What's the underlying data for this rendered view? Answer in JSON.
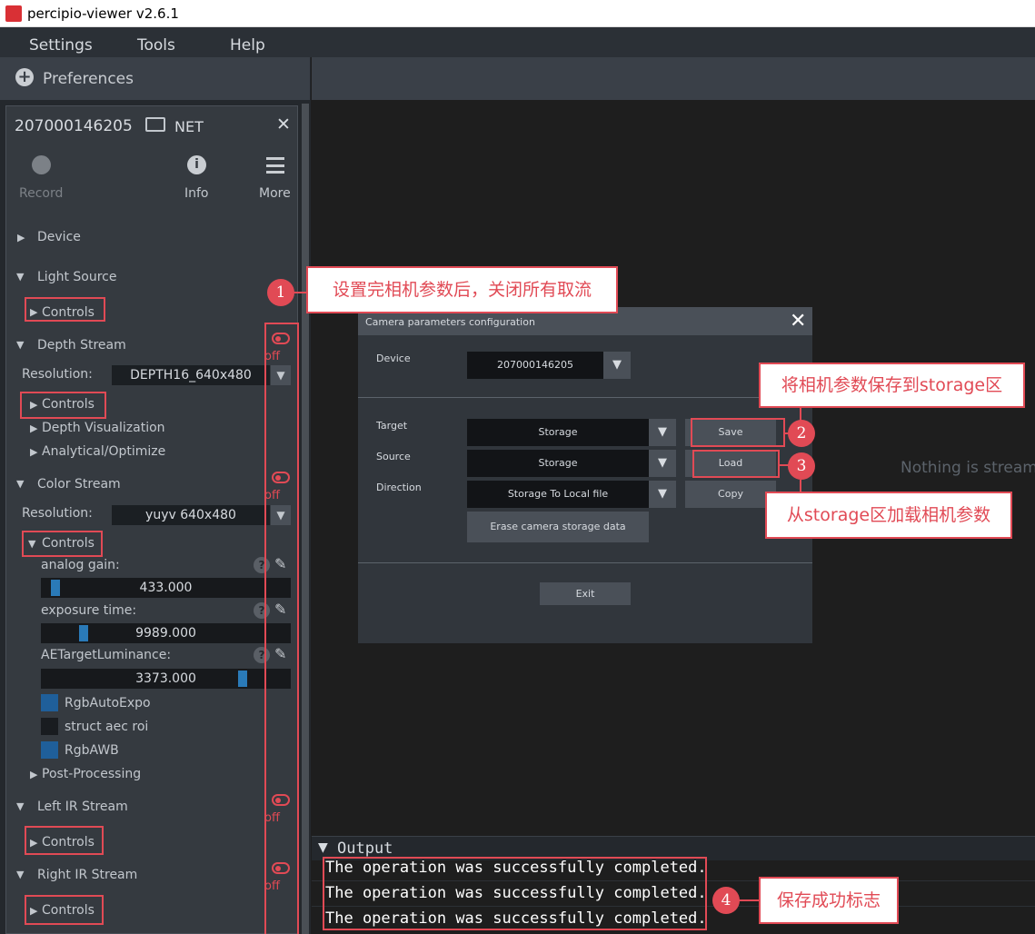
{
  "window": {
    "title": "percipio-viewer v2.6.1"
  },
  "menubar": {
    "settings": "Settings",
    "tools": "Tools",
    "help": "Help"
  },
  "preferences": {
    "label": "Preferences"
  },
  "device_panel": {
    "serial": "207000146205",
    "interface": "NET",
    "record_label": "Record",
    "info_label": "Info",
    "more_label": "More",
    "device_section": "Device",
    "light_source_section": "Light Source",
    "controls_label": "Controls",
    "depth_stream_section": "Depth Stream",
    "resolution_label": "Resolution:",
    "depth_resolution": "DEPTH16_640x480",
    "depth_visualization": "Depth Visualization",
    "analytical_optimize": "Analytical/Optimize",
    "color_stream_section": "Color Stream",
    "color_resolution": "yuyv 640x480",
    "off_label": "off",
    "analog_gain_label": "analog gain:",
    "analog_gain_value": "433.000",
    "analog_gain_level": 0.04,
    "exposure_time_label": "exposure time:",
    "exposure_time_value": "9989.000",
    "exposure_time_level": 0.16,
    "ae_target_label": "AETargetLuminance:",
    "ae_target_value": "3373.000",
    "ae_target_level": 0.82,
    "rgb_auto_expo": "RgbAutoExpo",
    "struct_aec_roi": "struct aec roi",
    "rgb_awb": "RgbAWB",
    "post_processing": "Post-Processing",
    "left_ir_section": "Left IR Stream",
    "right_ir_section": "Right IR Stream"
  },
  "viewport": {
    "status": "Nothing is stream"
  },
  "dialog": {
    "title": "Camera parameters configuration",
    "device_label": "Device",
    "device_value": "207000146205",
    "target_label": "Target",
    "target_value": "Storage",
    "source_label": "Source",
    "source_value": "Storage",
    "direction_label": "Direction",
    "direction_value": "Storage To Local file",
    "save": "Save",
    "load": "Load",
    "copy": "Copy",
    "erase": "Erase camera storage data",
    "exit": "Exit"
  },
  "annotations": {
    "n1": "1",
    "text1": "设置完相机参数后，关闭所有取流",
    "n2": "2",
    "text2": "将相机参数保存到storage区",
    "n3": "3",
    "text3": "从storage区加载相机参数",
    "n4": "4",
    "text4": "保存成功标志"
  },
  "output": {
    "title": "Output",
    "lines": [
      "The operation was successfully completed.",
      "The operation was successfully completed.",
      "The operation was successfully completed."
    ]
  },
  "colors": {
    "accent_red": "#e14a55",
    "slider_blue": "#2a7ab8"
  }
}
